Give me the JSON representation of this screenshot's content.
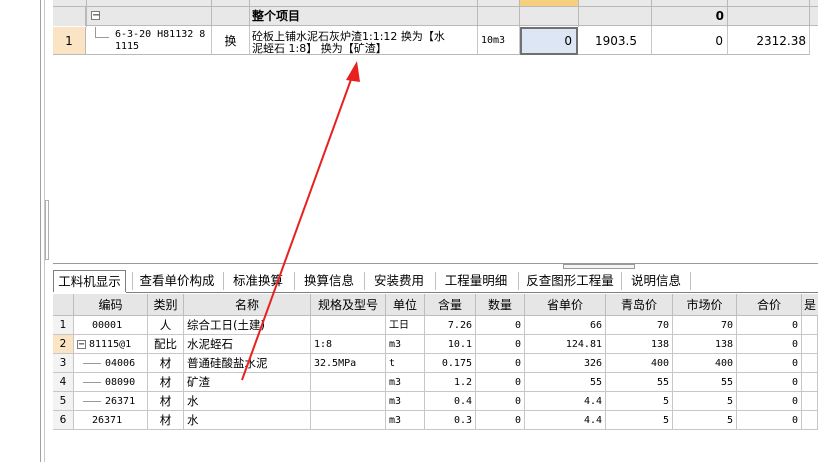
{
  "top_grid": {
    "group_row": {
      "label": "整个项目",
      "total": "0"
    },
    "rows": [
      {
        "num": "1",
        "code_line1": "6-3-20 H81132 8",
        "code_line2": "1115",
        "type": "换",
        "name_line1": "砼板上铺水泥石灰炉渣1:1:12  换为【水",
        "name_line2": "泥蛭石 1:8】  换为【矿渣】",
        "unit": "10m3",
        "qty": "0",
        "price": "1903.5",
        "total": "0",
        "other": "2312.38"
      }
    ]
  },
  "tabs": [
    {
      "label": "工料机显示"
    },
    {
      "label": "查看单价构成"
    },
    {
      "label": "标准换算"
    },
    {
      "label": "换算信息"
    },
    {
      "label": "安装费用"
    },
    {
      "label": "工程量明细"
    },
    {
      "label": "反查图形工程量"
    },
    {
      "label": "说明信息"
    }
  ],
  "columns": [
    "编码",
    "类别",
    "名称",
    "规格及型号",
    "单位",
    "含量",
    "数量",
    "省单价",
    "青岛价",
    "市场价",
    "合价",
    "是"
  ],
  "rows": [
    {
      "num": "1",
      "code": "00001",
      "cat": "人",
      "name": "综合工日(土建)",
      "spec": "",
      "unit": "工日",
      "content": "7.26",
      "qty": "0",
      "prov": "66",
      "qd": "70",
      "market": "70",
      "total": "0"
    },
    {
      "num": "2",
      "code": "81115@1",
      "cat": "配比",
      "name": "水泥蛭石",
      "spec": "1:8",
      "unit": "m3",
      "content": "10.1",
      "qty": "0",
      "prov": "124.81",
      "qd": "138",
      "market": "138",
      "total": "0"
    },
    {
      "num": "3",
      "code": "04006",
      "cat": "材",
      "name": "普通硅酸盐水泥",
      "spec": "32.5MPa",
      "unit": "t",
      "content": "0.175",
      "qty": "0",
      "prov": "326",
      "qd": "400",
      "market": "400",
      "total": "0"
    },
    {
      "num": "4",
      "code": "08090",
      "cat": "材",
      "name": "矿渣",
      "spec": "",
      "unit": "m3",
      "content": "1.2",
      "qty": "0",
      "prov": "55",
      "qd": "55",
      "market": "55",
      "total": "0"
    },
    {
      "num": "5",
      "code": "26371",
      "cat": "材",
      "name": "水",
      "spec": "",
      "unit": "m3",
      "content": "0.4",
      "qty": "0",
      "prov": "4.4",
      "qd": "5",
      "market": "5",
      "total": "0"
    },
    {
      "num": "6",
      "code": "26371",
      "cat": "材",
      "name": "水",
      "spec": "",
      "unit": "m3",
      "content": "0.3",
      "qty": "0",
      "prov": "4.4",
      "qd": "5",
      "market": "5",
      "total": "0"
    }
  ],
  "colors": {
    "arrow": "#e8211f",
    "selected_cell": "#dce6f4",
    "row_header": "#fbe4c4",
    "group_row": "#e8e8e8"
  }
}
